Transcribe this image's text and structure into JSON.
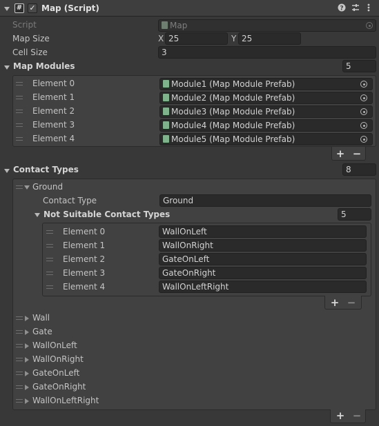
{
  "component": {
    "title": "Map (Script)",
    "enabled_mark": "✓",
    "help_icon": "help-icon",
    "presets_icon": "presets-icon",
    "menu_icon": "kebab-menu-icon"
  },
  "properties": {
    "script": {
      "label": "Script",
      "value": "Map"
    },
    "map_size": {
      "label": "Map Size",
      "x_label": "X",
      "x_value": "25",
      "y_label": "Y",
      "y_value": "25"
    },
    "cell_size": {
      "label": "Cell Size",
      "value": "3"
    }
  },
  "map_modules": {
    "label": "Map Modules",
    "count": "5",
    "elements": [
      {
        "label": "Element 0",
        "value": "Module1 (Map Module Prefab)"
      },
      {
        "label": "Element 1",
        "value": "Module2 (Map Module Prefab)"
      },
      {
        "label": "Element 2",
        "value": "Module3 (Map Module Prefab)"
      },
      {
        "label": "Element 3",
        "value": "Module4 (Map Module Prefab)"
      },
      {
        "label": "Element 4",
        "value": "Module5 (Map Module Prefab)"
      }
    ],
    "add": "+",
    "remove": "−"
  },
  "contact_types": {
    "label": "Contact Types",
    "count": "8",
    "expanded": {
      "name": "Ground",
      "contact_type_label": "Contact Type",
      "contact_type_value": "Ground",
      "not_suitable": {
        "label": "Not Suitable Contact Types",
        "count": "5",
        "elements": [
          {
            "label": "Element 0",
            "value": "WallOnLeft"
          },
          {
            "label": "Element 1",
            "value": "WallOnRight"
          },
          {
            "label": "Element 2",
            "value": "GateOnLeft"
          },
          {
            "label": "Element 3",
            "value": "GateOnRight"
          },
          {
            "label": "Element 4",
            "value": "WallOnLeftRight"
          }
        ],
        "add": "+",
        "remove": "−"
      }
    },
    "collapsed": [
      "Wall",
      "Gate",
      "WallOnLeft",
      "WallOnRight",
      "GateOnLeft",
      "GateOnRight",
      "WallOnLeftRight"
    ],
    "add": "+",
    "remove": "−"
  }
}
